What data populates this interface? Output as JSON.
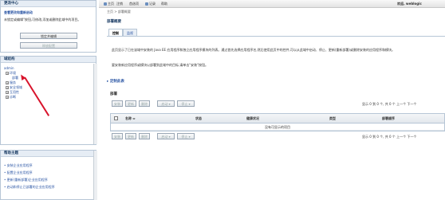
{
  "sidebar": {
    "change_center": {
      "title": "更改中心",
      "link": "查看更改和重新启动",
      "desc": "未锁定或编辑\"按钮,可修改,添加或删除此域中的项目。",
      "lock_button": "锁定并编辑",
      "release_button": "释放配置"
    },
    "domain_structure": {
      "title": "域结构",
      "root": "admin",
      "items": [
        "环境",
        "部署",
        "服务",
        "安全领域",
        "互用性",
        "诊断"
      ]
    },
    "help": {
      "title": "帮助主题",
      "items": [
        "安装企业应用程序",
        "配置企业应用程序",
        "更新(重新部署)企业应用程序",
        "启动和停止已部署的企业应用程序"
      ]
    }
  },
  "topbar": {
    "items": [
      "主页",
      "注销",
      "首选项",
      "记录",
      "帮助"
    ],
    "welcome": "欢迎, weblogic"
  },
  "breadcrumb": "主页 > 部署概要",
  "page": {
    "heading": "部署概要",
    "tabs": [
      "控制",
      "监视"
    ],
    "description_1": "此页显示了已在该域中安装的 Java EE 应用程序和独立应用程序模块的列表。通过首先选择应用程序名,然后使用此页中的控件,可以从此域中启动、停止、更新(重新部署)或删除安装的应用程序和模块。",
    "description_2": "要安装新应用程序或模块以部署到此域中的目标,请单击\"安装\"按钮。",
    "customize_link": "定制此表",
    "deployments_title": "部署"
  },
  "toolbar": {
    "buttons": [
      "安装",
      "更新",
      "删除",
      "启动",
      "停止"
    ]
  },
  "table": {
    "columns": [
      "名称",
      "状态",
      "健康状况",
      "类型",
      "部署顺序"
    ],
    "empty_message": "没有可显示的项目",
    "pager": "显示 0 到 0 个, 共 0 个  上一个  下一个"
  }
}
